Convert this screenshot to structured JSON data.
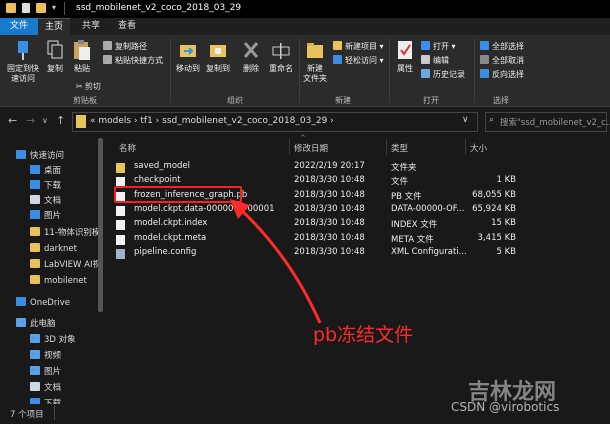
{
  "window": {
    "title": "ssd_mobilenet_v2_coco_2018_03_29"
  },
  "tabs": [
    "文件",
    "主页",
    "共享",
    "查看"
  ],
  "ribbon": {
    "clipboard": {
      "pin": "固定到快\n速访问",
      "copy": "复制",
      "paste": "粘贴",
      "copy_path": "复制路径",
      "paste_shortcut": "粘贴快捷方式",
      "cut": "剪切",
      "label": "剪贴板"
    },
    "organize": {
      "move_to": "移动到",
      "copy_to": "复制到",
      "delete": "删除",
      "rename": "重命名",
      "label": "组织"
    },
    "new": {
      "new_folder": "新建\n文件夹",
      "new_item": "新建项目 ▾",
      "easy_access": "轻松访问 ▾",
      "label": "新建"
    },
    "open": {
      "properties": "属性",
      "open": "打开 ▾",
      "edit": "编辑",
      "history": "历史记录",
      "label": "打开"
    },
    "select": {
      "select_all": "全部选择",
      "select_none": "全部取消",
      "invert": "反向选择",
      "label": "选择"
    }
  },
  "address": {
    "crumbs": "«  models  ›  tf1  ›  ssd_mobilenet_v2_coco_2018_03_29  ›",
    "search_placeholder": "搜索\"ssd_mobilenet_v2_c..."
  },
  "nav_pane": [
    {
      "label": "快速访问",
      "icon": "star-icon",
      "color": "#3a8ee6"
    },
    {
      "label": "桌面",
      "icon": "desktop-icon",
      "color": "#3a8ee6"
    },
    {
      "label": "下载",
      "icon": "download-icon",
      "color": "#3a8ee6"
    },
    {
      "label": "文档",
      "icon": "document-icon",
      "color": "#cfd8e3"
    },
    {
      "label": "图片",
      "icon": "picture-icon",
      "color": "#3a8ee6"
    },
    {
      "label": "11-物体识别模型",
      "icon": "folder-icon",
      "color": "#e8c25a"
    },
    {
      "label": "darknet",
      "icon": "folder-icon",
      "color": "#e8c25a"
    },
    {
      "label": "LabVIEW AI视觉",
      "icon": "folder-icon",
      "color": "#e8c25a"
    },
    {
      "label": "mobilenet",
      "icon": "folder-icon",
      "color": "#e8c25a"
    },
    {
      "label": "OneDrive",
      "icon": "cloud-icon",
      "color": "#3a8ee6"
    },
    {
      "label": "此电脑",
      "icon": "computer-icon",
      "color": "#5aa0e8"
    },
    {
      "label": "3D 对象",
      "icon": "cube-icon",
      "color": "#5aa0e8"
    },
    {
      "label": "视频",
      "icon": "video-icon",
      "color": "#5aa0e8"
    },
    {
      "label": "图片",
      "icon": "picture-icon",
      "color": "#5aa0e8"
    },
    {
      "label": "文档",
      "icon": "document-icon",
      "color": "#cfd8e3"
    },
    {
      "label": "下载",
      "icon": "download-icon",
      "color": "#3a8ee6"
    }
  ],
  "columns": [
    "名称",
    "修改日期",
    "类型",
    "大小"
  ],
  "files": [
    {
      "name": "saved_model",
      "date": "2022/2/19 20:17",
      "type": "文件夹",
      "size": "",
      "icon": "folder-icon"
    },
    {
      "name": "checkpoint",
      "date": "2018/3/30 10:48",
      "type": "文件",
      "size": "1 KB",
      "icon": "file-icon"
    },
    {
      "name": "frozen_inference_graph.pb",
      "date": "2018/3/30 10:48",
      "type": "PB 文件",
      "size": "68,055 KB",
      "icon": "file-icon"
    },
    {
      "name": "model.ckpt.data-00000-of-00001",
      "date": "2018/3/30 10:48",
      "type": "DATA-00000-OF...",
      "size": "65,924 KB",
      "icon": "file-icon"
    },
    {
      "name": "model.ckpt.index",
      "date": "2018/3/30 10:48",
      "type": "INDEX 文件",
      "size": "15 KB",
      "icon": "file-icon"
    },
    {
      "name": "model.ckpt.meta",
      "date": "2018/3/30 10:48",
      "type": "META 文件",
      "size": "3,415 KB",
      "icon": "file-icon"
    },
    {
      "name": "pipeline.config",
      "date": "2018/3/30 10:48",
      "type": "XML Configurati...",
      "size": "5 KB",
      "icon": "config-icon"
    }
  ],
  "status": {
    "count": "7 个项目"
  },
  "annotation": {
    "text": "pb冻结文件",
    "color": "#ff2a2a"
  },
  "watermark": {
    "line1": "吉林龙网",
    "line2": "CSDN @virobotics"
  }
}
